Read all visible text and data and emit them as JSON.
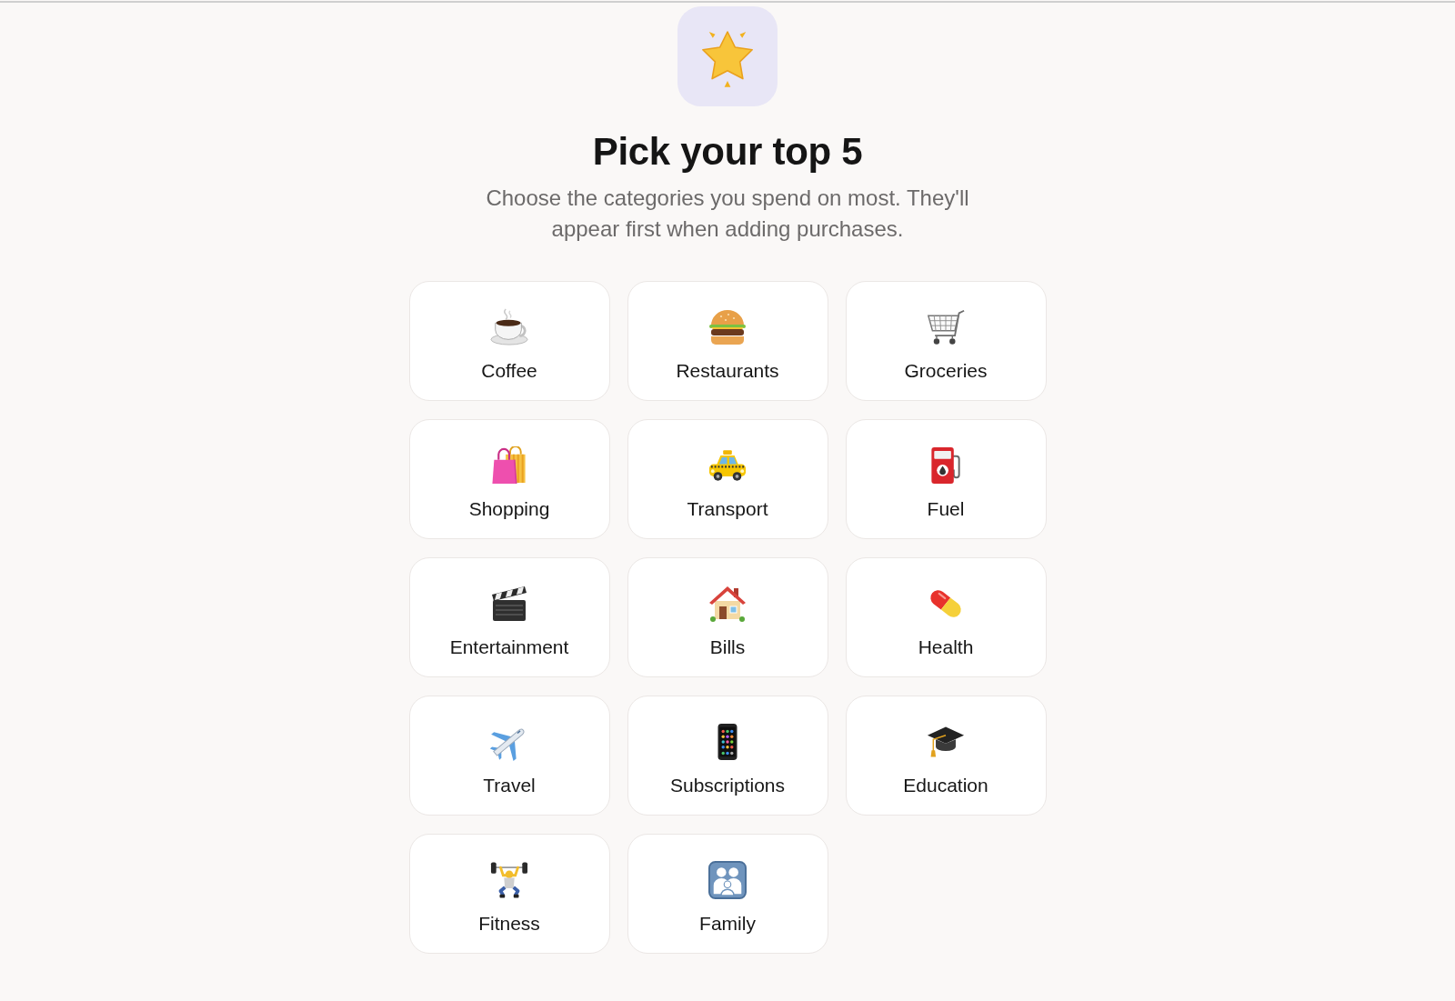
{
  "header": {
    "title": "Pick your top 5",
    "subtitle": "Choose the categories you spend on most. They'll appear first when adding purchases."
  },
  "categories": [
    {
      "label": "Coffee",
      "selected": false
    },
    {
      "label": "Restaurants",
      "selected": false
    },
    {
      "label": "Groceries",
      "selected": false
    },
    {
      "label": "Shopping",
      "selected": false
    },
    {
      "label": "Transport",
      "selected": false
    },
    {
      "label": "Fuel",
      "selected": false
    },
    {
      "label": "Entertainment",
      "selected": false
    },
    {
      "label": "Bills",
      "selected": false
    },
    {
      "label": "Health",
      "selected": false
    },
    {
      "label": "Travel",
      "selected": false
    },
    {
      "label": "Subscriptions",
      "selected": false
    },
    {
      "label": "Education",
      "selected": false
    },
    {
      "label": "Fitness",
      "selected": false
    },
    {
      "label": "Family",
      "selected": false
    }
  ]
}
